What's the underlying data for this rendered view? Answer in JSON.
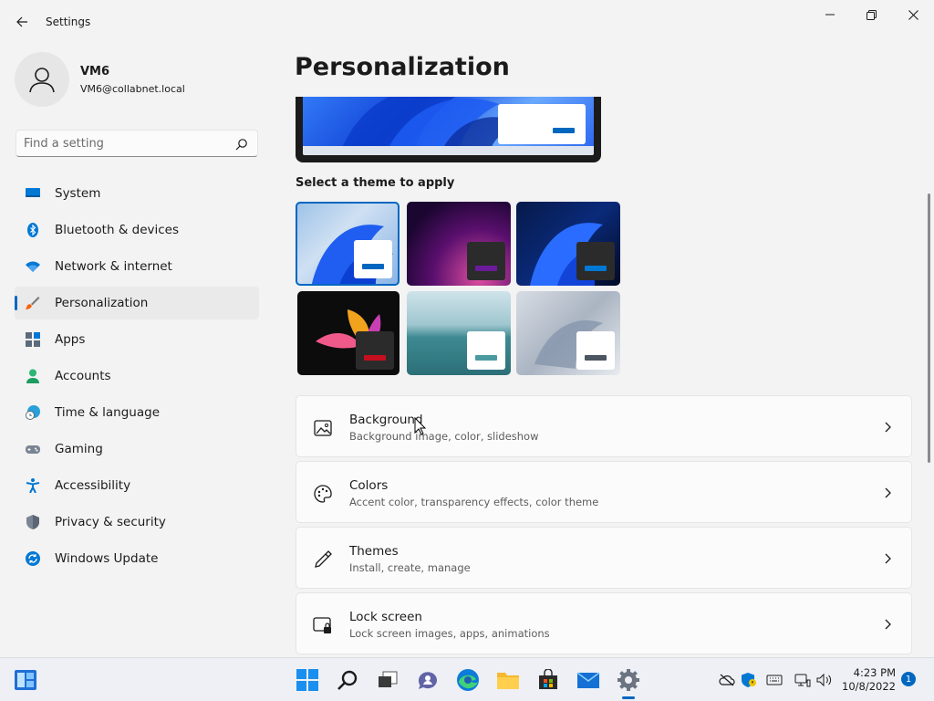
{
  "window": {
    "app_title": "Settings"
  },
  "user": {
    "name": "VM6",
    "email": "VM6@collabnet.local"
  },
  "search": {
    "placeholder": "Find a setting",
    "value": ""
  },
  "nav": {
    "items": [
      {
        "label": "System",
        "icon": "monitor-icon"
      },
      {
        "label": "Bluetooth & devices",
        "icon": "bluetooth-icon"
      },
      {
        "label": "Network & internet",
        "icon": "wifi-icon"
      },
      {
        "label": "Personalization",
        "icon": "brush-icon",
        "selected": true
      },
      {
        "label": "Apps",
        "icon": "apps-icon"
      },
      {
        "label": "Accounts",
        "icon": "person-icon"
      },
      {
        "label": "Time & language",
        "icon": "globe-clock-icon"
      },
      {
        "label": "Gaming",
        "icon": "gamepad-icon"
      },
      {
        "label": "Accessibility",
        "icon": "accessibility-icon"
      },
      {
        "label": "Privacy & security",
        "icon": "shield-icon"
      },
      {
        "label": "Windows Update",
        "icon": "update-icon"
      }
    ]
  },
  "page": {
    "title": "Personalization",
    "themes_label": "Select a theme to apply"
  },
  "themes": [
    {
      "name": "windows-light",
      "selected": true,
      "accent": "#0067c0"
    },
    {
      "name": "glow",
      "accent": "#6a1b9a"
    },
    {
      "name": "windows-dark",
      "accent": "#0078d4"
    },
    {
      "name": "captured-motion",
      "accent": "#c50f1f"
    },
    {
      "name": "sunrise",
      "accent": "#4a9ba0"
    },
    {
      "name": "flow",
      "accent": "#4c5562"
    }
  ],
  "cards": [
    {
      "title": "Background",
      "subtitle": "Background image, color, slideshow",
      "icon": "image-icon"
    },
    {
      "title": "Colors",
      "subtitle": "Accent color, transparency effects, color theme",
      "icon": "palette-icon"
    },
    {
      "title": "Themes",
      "subtitle": "Install, create, manage",
      "icon": "pen-icon"
    },
    {
      "title": "Lock screen",
      "subtitle": "Lock screen images, apps, animations",
      "icon": "lock-screen-icon"
    }
  ],
  "taskbar": {
    "apps": [
      "widgets-icon",
      "start-icon",
      "search-icon",
      "task-view-icon",
      "chat-icon",
      "edge-icon",
      "file-explorer-icon",
      "store-icon",
      "mail-icon",
      "settings-icon"
    ],
    "clock_time": "4:23 PM",
    "clock_date": "10/8/2022",
    "notification_count": "1"
  },
  "colors": {
    "accent": "#0067c0",
    "background": "#f3f3f3",
    "card": "#fbfbfb"
  }
}
